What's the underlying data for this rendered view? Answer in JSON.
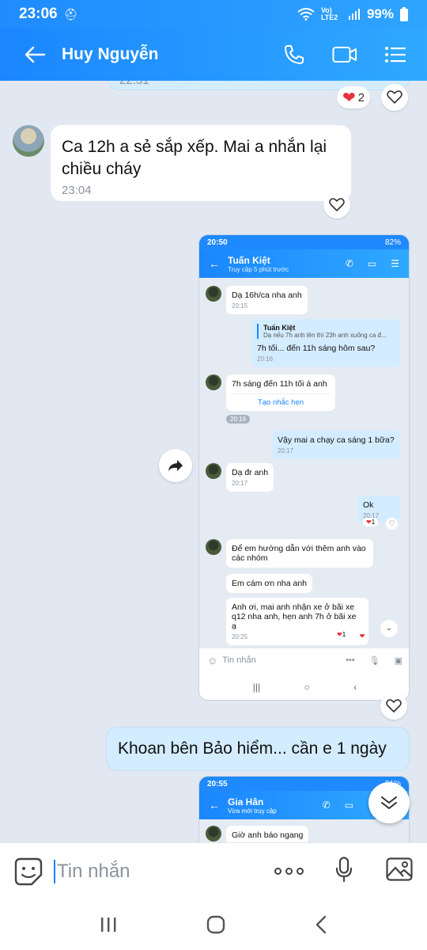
{
  "status_bar": {
    "time": "23:06",
    "network": "Vo) LTE2",
    "battery": "99%"
  },
  "header": {
    "contact_name": "Huy Nguyễn"
  },
  "messages": {
    "prev_timestamp": "22:31",
    "prev_reaction_count": "2",
    "msg1_text": "Ca 12h a sẻ sắp xếp. Mai a nhắn lại chiều cháy",
    "msg1_time": "23:04",
    "msg_out_text": "Khoan bên Bảo hiểm... cần e 1 ngày"
  },
  "shot1": {
    "time": "20:50",
    "battery": "82%",
    "contact_name": "Tuấn Kiệt",
    "contact_status": "Truy cập 5 phút trước",
    "m1_text": "Dạ 16h/ca nha anh",
    "m1_time": "20:15",
    "quote_name": "Tuấn Kiệt",
    "quote_text": "Dạ nếu 7h anh lên thì 23h anh xuống ca đ...",
    "reply_text": "7h tối... đến 11h sáng hôm sau?",
    "reply_time": "20:16",
    "m2_text": "7h sáng đến 11h tối á anh",
    "m2_action": "Tạo nhắc hẹn",
    "m2_time": "20:16",
    "m3_text": "Vậy mai a chạy ca sáng 1 bữa?",
    "m3_time": "20:17",
    "m4_text": "Dạ đr anh",
    "m4_time": "20:17",
    "m5_text": "Ok",
    "m5_time": "20:17",
    "m5_react": "1",
    "m6_text": "Để em hướng dẫn với thêm anh vào các nhóm",
    "m7_text": "Em cám ơn nha anh",
    "m8_text": "Anh ơi, mai anh nhận xe ở bãi xe q12 nha anh, hẹn anh 7h ở bãi xe ạ",
    "m8_time": "20:25",
    "m8_react": "1",
    "input_placeholder": "Tin nhắn"
  },
  "shot2": {
    "time": "20:55",
    "battery": "81%",
    "contact_name": "Gia Hân",
    "contact_status": "Vừa mới truy cập",
    "m1_text": "Giờ anh báo ngang"
  },
  "input": {
    "placeholder": "Tin nhắn"
  },
  "colors": {
    "accent": "#1b86ff",
    "out_bubble": "#d4ecff",
    "background": "#e2e8f1"
  }
}
